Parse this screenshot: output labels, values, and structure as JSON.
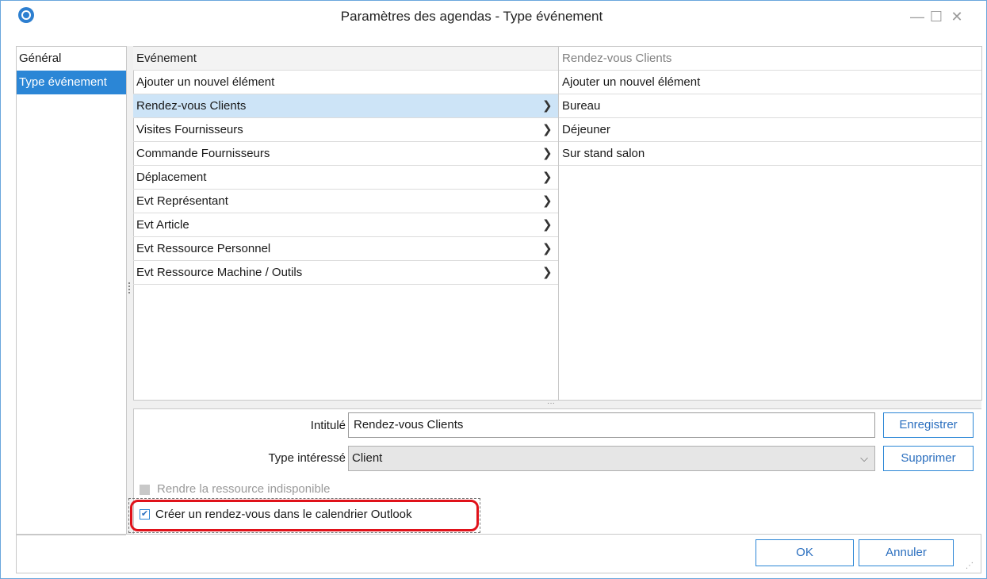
{
  "window": {
    "title": "Paramètres des agendas -  Type événement",
    "controls": {
      "minimize": "—",
      "maximize": "☐",
      "close": "✕"
    }
  },
  "nav": {
    "items": [
      {
        "label": "Général",
        "selected": false
      },
      {
        "label": "Type événement",
        "selected": true
      }
    ]
  },
  "events": {
    "header": "Evénement",
    "add_label": "Ajouter un nouvel élément",
    "items": [
      {
        "label": "Rendez-vous Clients",
        "selected": true
      },
      {
        "label": "Visites Fournisseurs"
      },
      {
        "label": "Commande Fournisseurs"
      },
      {
        "label": "Déplacement"
      },
      {
        "label": "Evt Représentant"
      },
      {
        "label": "Evt Article"
      },
      {
        "label": "Evt Ressource Personnel"
      },
      {
        "label": "Evt Ressource Machine / Outils"
      }
    ],
    "chevron_icon": "chevron-right-icon"
  },
  "subevents": {
    "header": "Rendez-vous Clients",
    "add_label": "Ajouter un nouvel élément",
    "items": [
      {
        "label": "Bureau"
      },
      {
        "label": "Déjeuner"
      },
      {
        "label": "Sur stand salon"
      }
    ]
  },
  "form": {
    "intitule_label": "Intitulé",
    "intitule_value": "Rendez-vous Clients",
    "type_label": "Type intéressé",
    "type_value": "Client",
    "save_button": "Enregistrer",
    "delete_button": "Supprimer",
    "unavailable_label": "Rendre la ressource indisponible",
    "outlook_label": "Créer un rendez-vous dans le calendrier Outlook",
    "outlook_checked": true
  },
  "footer": {
    "ok": "OK",
    "cancel": "Annuler"
  },
  "colors": {
    "accent": "#2b86d6",
    "selection": "#cde4f7",
    "highlight": "#e0121a"
  }
}
